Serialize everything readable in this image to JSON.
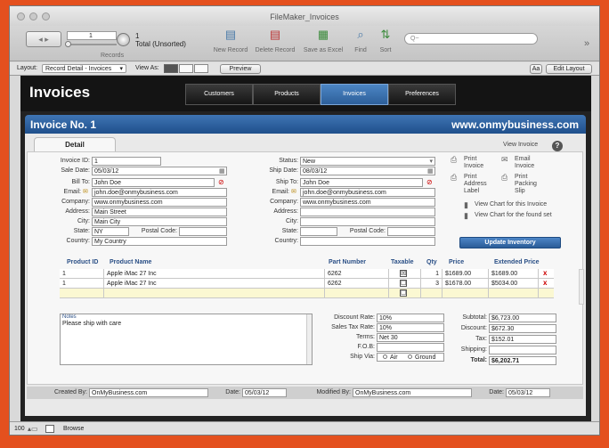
{
  "window": {
    "title": "FileMaker_Invoices"
  },
  "toolbar": {
    "record_number": "1",
    "record_total": "1",
    "record_status": "Total (Unsorted)",
    "records_label": "Records",
    "new_record": "New Record",
    "delete_record": "Delete Record",
    "save_excel": "Save as Excel",
    "find": "Find",
    "sort": "Sort",
    "search_placeholder": "Q~",
    "overflow": "»"
  },
  "layoutbar": {
    "layout_label": "Layout:",
    "layout_value": "Record Detail - Invoices",
    "view_as_label": "View As:",
    "preview": "Preview",
    "aa": "Aa",
    "edit_layout": "Edit Layout"
  },
  "app": {
    "title": "Invoices",
    "nav": [
      {
        "label": "Customers",
        "active": false
      },
      {
        "label": "Products",
        "active": false
      },
      {
        "label": "Invoices",
        "active": true
      },
      {
        "label": "Preferences",
        "active": false
      }
    ],
    "invoice_heading": "Invoice No. 1",
    "website": "www.onmybusiness.com",
    "detail_tab": "Detail",
    "view_invoice": "View Invoice",
    "help": "?"
  },
  "bill": {
    "invoice_id_label": "Invoice ID:",
    "invoice_id": "1",
    "sale_date_label": "Sale Date:",
    "sale_date": "05/03/12",
    "bill_to_label": "Bill To:",
    "bill_to": "John Doe",
    "email_label": "Email:",
    "email": "john.doe@onmybusiness.com",
    "company_label": "Company:",
    "company": "www.onmybusiness.com",
    "address_label": "Address:",
    "address": "Main Street",
    "city_label": "City:",
    "city": "Main City",
    "state_label": "State:",
    "state": "NY",
    "postal_label": "Postal Code:",
    "postal": "",
    "country_label": "Country:",
    "country": "My Country"
  },
  "ship": {
    "status_label": "Status:",
    "status": "New",
    "ship_date_label": "Ship Date:",
    "ship_date": "08/03/12",
    "ship_to_label": "Ship To:",
    "ship_to": "John Doe",
    "email_label": "Email:",
    "email": "john.doe@onmybusiness.com",
    "company_label": "Company:",
    "company": "www.onmybusiness.com",
    "address_label": "Address:",
    "address": "",
    "city_label": "City:",
    "city": "",
    "state_label": "State:",
    "state": "",
    "postal_label": "Postal Code:",
    "postal": "",
    "country_label": "Country:",
    "country": ""
  },
  "actions": {
    "print_invoice": "Print Invoice",
    "email_invoice": "Email Invoice",
    "print_address_label": "Print Address Label",
    "print_packing_slip": "Print Packing Slip",
    "chart_invoice": "View Chart for this Invoice",
    "chart_found": "View Chart for the found set",
    "update_inventory": "Update Inventory"
  },
  "table": {
    "headers": [
      "Product ID",
      "Product Name",
      "Part Number",
      "Taxable",
      "Qty",
      "Price",
      "Extended Price"
    ],
    "rows": [
      {
        "id": "1",
        "name": "Apple iMac 27 Inc",
        "part": "6262",
        "taxable": "☒",
        "qty": "1",
        "price": "$1689.00",
        "extended": "$1689.00",
        "del": "x"
      },
      {
        "id": "1",
        "name": "Apple iMac 27 Inc",
        "part": "6262",
        "taxable": "☐",
        "qty": "3",
        "price": "$1678.00",
        "extended": "$5034.00",
        "del": "x"
      }
    ],
    "new_row_taxable": "☐"
  },
  "notes": {
    "label": "Notes",
    "text": "Please ship with care"
  },
  "terms": {
    "discount_rate_label": "Discount Rate:",
    "discount_rate": "10%",
    "sales_tax_label": "Sales Tax Rate:",
    "sales_tax": "10%",
    "terms_label": "Terms:",
    "terms": "Net 30",
    "fob_label": "F.O.B:",
    "fob": "",
    "ship_via_label": "Ship Via:",
    "ship_via_air": "Air",
    "ship_via_ground": "Ground"
  },
  "totals": {
    "subtotal_label": "Subtotal:",
    "subtotal": "$6,723.00",
    "discount_label": "Discount:",
    "discount": "$672.30",
    "tax_label": "Tax:",
    "tax": "$152.01",
    "shipping_label": "Shipping:",
    "shipping": "",
    "total_label": "Total:",
    "total": "$6,202.71"
  },
  "footer": {
    "created_by_label": "Created By:",
    "created_by": "OnMyBusiness.com",
    "date_label": "Date:",
    "created_date": "05/03/12",
    "modified_by_label": "Modified By:",
    "modified_by": "OnMyBusiness.com",
    "date2_label": "Date:",
    "modified_date": "05/03/12"
  },
  "status": {
    "zoom": "100",
    "mode": "Browse"
  },
  "colors": {
    "accent": "#2d5f9a",
    "brand_bg": "#e4501e"
  }
}
